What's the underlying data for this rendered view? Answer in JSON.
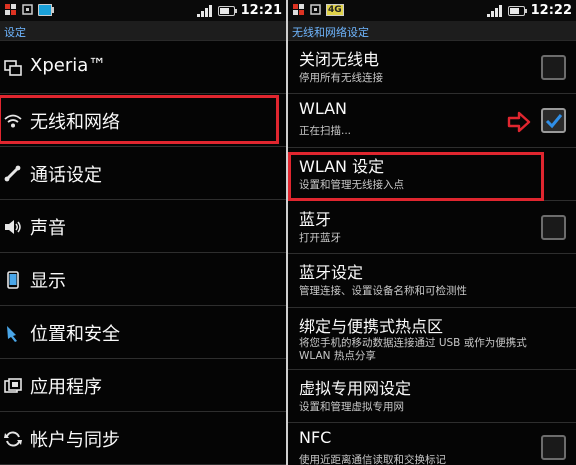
{
  "left": {
    "status": {
      "time": "12:21"
    },
    "title": "设定",
    "items": [
      {
        "label": "Xperia™",
        "icon": "monitor-icon"
      },
      {
        "label": "无线和网络",
        "icon": "wifi-icon"
      },
      {
        "label": "通话设定",
        "icon": "phone-icon"
      },
      {
        "label": "声音",
        "icon": "speaker-icon"
      },
      {
        "label": "显示",
        "icon": "display-icon"
      },
      {
        "label": "位置和安全",
        "icon": "location-security-icon"
      },
      {
        "label": "应用程序",
        "icon": "apps-icon"
      },
      {
        "label": "帐户与同步",
        "icon": "sync-icon"
      }
    ]
  },
  "right": {
    "status": {
      "time": "12:22",
      "battery_badge": "4G"
    },
    "title": "无线和网络设定",
    "items": [
      {
        "title": "关闭无线电",
        "subtitle": "停用所有无线连接",
        "checked": false
      },
      {
        "title": "WLAN",
        "subtitle": "正在扫描...",
        "checked": true
      },
      {
        "title": "WLAN 设定",
        "subtitle": "设置和管理无线接入点"
      },
      {
        "title": "蓝牙",
        "subtitle": "打开蓝牙",
        "checked": false
      },
      {
        "title": "蓝牙设定",
        "subtitle": "管理连接、设置设备名称和可检测性"
      },
      {
        "title": "绑定与便携式热点区",
        "subtitle_line1": "将您手机的移动数据连接通过 USB 或作为便携式",
        "subtitle_line2": "WLAN 热点分享"
      },
      {
        "title": "虚拟专用网设定",
        "subtitle": "设置和管理虚拟专用网"
      },
      {
        "title": "NFC",
        "subtitle": "使用近距离通信读取和交换标记",
        "checked": false
      }
    ]
  },
  "colors": {
    "highlight": "#e0262f",
    "title_text": "#6fb6ff",
    "check_mark": "#2f8fe8"
  }
}
